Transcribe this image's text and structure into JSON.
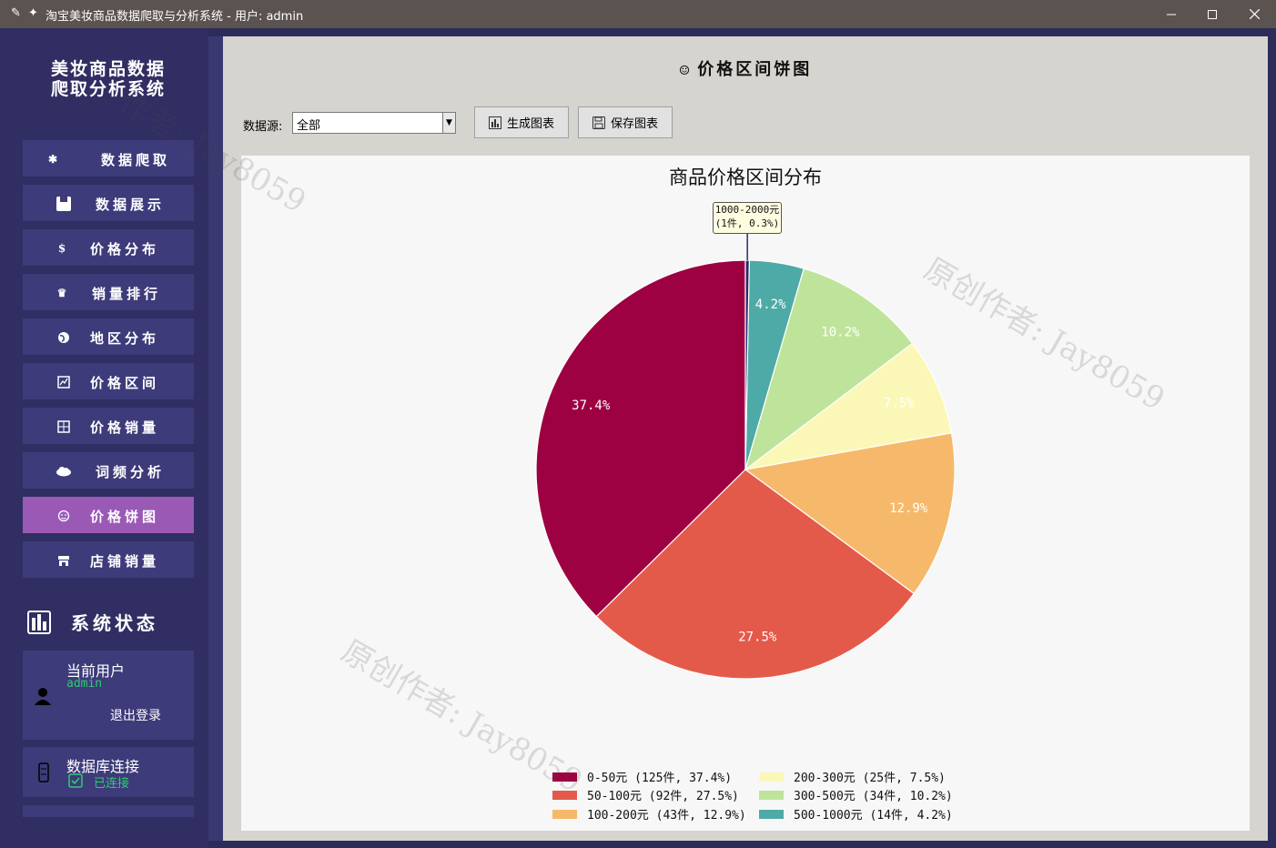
{
  "window": {
    "title": "淘宝美妆商品数据爬取与分析系统 - 用户: admin",
    "icons": [
      "feather-icon",
      "sparkle-icon"
    ],
    "controls": [
      "minimize",
      "maximize",
      "close"
    ]
  },
  "sidebar": {
    "app_title_line1": "美妆商品数据",
    "app_title_line2": "爬取分析系统",
    "items": [
      {
        "label": "数据爬取",
        "icon": "spider-icon"
      },
      {
        "label": "数据展示",
        "icon": "package-icon"
      },
      {
        "label": "价格分布",
        "icon": "money-bag-icon"
      },
      {
        "label": "销量排行",
        "icon": "trophy-icon"
      },
      {
        "label": "地区分布",
        "icon": "globe-icon"
      },
      {
        "label": "价格区间",
        "icon": "chart-icon"
      },
      {
        "label": "价格销量",
        "icon": "grid-chart-icon"
      },
      {
        "label": "词频分析",
        "icon": "cloud-icon"
      },
      {
        "label": "价格饼图",
        "icon": "pie-icon"
      },
      {
        "label": "店铺销量",
        "icon": "store-icon"
      }
    ],
    "active_index": 8,
    "status_title": "系统状态",
    "user_card": {
      "title": "当前用户",
      "username": "admin",
      "logout": "退出登录"
    },
    "db_card": {
      "title": "数据库连接",
      "status": "已连接"
    },
    "colors": {
      "bg": "#302e62",
      "button": "#3e3b7a",
      "active": "#9b59b6",
      "ok": "#2ecc71"
    }
  },
  "main": {
    "page_title": "价格区间饼图",
    "source_label": "数据源:",
    "source_value": "全部",
    "generate_button": "生成图表",
    "save_button": "保存图表"
  },
  "chart_data": {
    "type": "pie",
    "title": "商品价格区间分布",
    "slices": [
      {
        "label": "0-50元",
        "count": 125,
        "percent": 37.4,
        "color": "#9e0142"
      },
      {
        "label": "50-100元",
        "count": 92,
        "percent": 27.5,
        "color": "#e45a4a"
      },
      {
        "label": "100-200元",
        "count": 43,
        "percent": 12.9,
        "color": "#f6b96b"
      },
      {
        "label": "200-300元",
        "count": 25,
        "percent": 7.5,
        "color": "#fbf8b7"
      },
      {
        "label": "300-500元",
        "count": 34,
        "percent": 10.2,
        "color": "#bee49b"
      },
      {
        "label": "500-1000元",
        "count": 14,
        "percent": 4.2,
        "color": "#4eaaa6"
      },
      {
        "label": "1000-2000元",
        "count": 1,
        "percent": 0.3,
        "color": "#2a2a6c"
      }
    ],
    "slice_labels": [
      "37.4%",
      "27.5%",
      "12.9%",
      "7.5%",
      "10.2%",
      "4.2%"
    ],
    "annotation": {
      "line1": "1000-2000元",
      "line2": "(1件, 0.3%)"
    },
    "legend": [
      "0-50元 (125件, 37.4%)",
      "50-100元 (92件, 27.5%)",
      "100-200元 (43件, 12.9%)",
      "200-300元 (25件, 7.5%)",
      "300-500元 (34件, 10.2%)",
      "500-1000元 (14件, 4.2%)"
    ]
  },
  "watermark": {
    "text1": "原创作者: Jay8059",
    "text2": "作者: Jay8059"
  }
}
